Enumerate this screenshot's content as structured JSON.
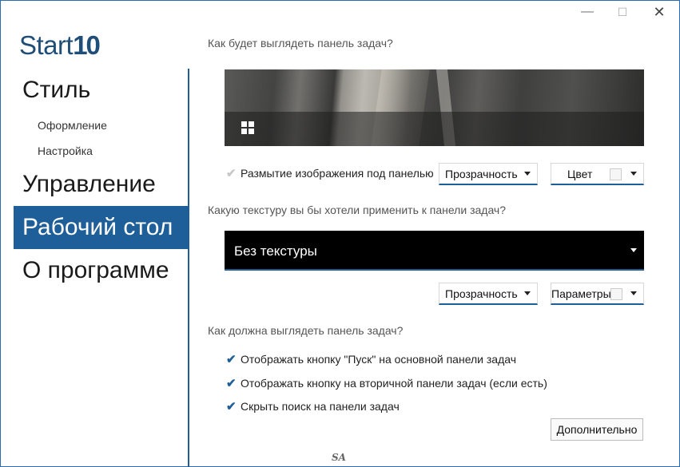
{
  "window": {
    "minimize_glyph": "—",
    "maximize_glyph": "☐",
    "close_glyph": "✕"
  },
  "logo": {
    "prefix": "Start",
    "number": "10"
  },
  "sidebar": {
    "style": "Стиль",
    "style_sub1": "Оформление",
    "style_sub2": "Настройка",
    "control": "Управление",
    "desktop": "Рабочий стол",
    "about": "О программе",
    "active_color": "#1f5f99"
  },
  "section1": {
    "heading": "Как будет выглядеть панель задач?",
    "blur_label": "Размытие изображения под панелью",
    "blur_checked": true,
    "transparency": "Прозрачность",
    "color": "Цвет"
  },
  "section2": {
    "heading": "Какую текстуру вы бы хотели применить к панели задач?",
    "texture": "Без текстуры",
    "transparency": "Прозрачность",
    "params": "Параметры"
  },
  "section3": {
    "heading": "Как должна выглядеть панель задач?",
    "options": [
      {
        "label": "Отображать кнопку \"Пуск\" на основной панели задач",
        "checked": true
      },
      {
        "label": "Отображать кнопку на вторичной панели задач (если есть)",
        "checked": true
      },
      {
        "label": "Скрыть поиск на панели задач",
        "checked": true
      }
    ],
    "more_button": "Дополнительно"
  },
  "watermark": "SA"
}
